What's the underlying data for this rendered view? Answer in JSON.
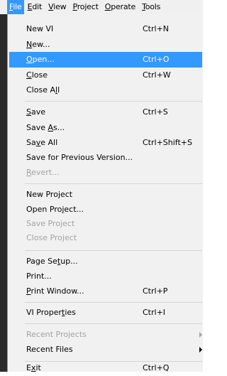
{
  "menubar": {
    "items": [
      {
        "pre": "",
        "ul": "F",
        "post": "ile"
      },
      {
        "pre": "",
        "ul": "E",
        "post": "dit"
      },
      {
        "pre": "",
        "ul": "V",
        "post": "iew"
      },
      {
        "pre": "",
        "ul": "P",
        "post": "roject"
      },
      {
        "pre": "",
        "ul": "O",
        "post": "perate"
      },
      {
        "pre": "",
        "ul": "T",
        "post": "ools"
      }
    ]
  },
  "file_menu": {
    "new_vi": {
      "pre": "New VI",
      "ul": "",
      "post": "",
      "shortcut": "Ctrl+N"
    },
    "new": {
      "pre": "",
      "ul": "N",
      "post": "ew..."
    },
    "open": {
      "pre": "",
      "ul": "O",
      "post": "pen...",
      "shortcut": "Ctrl+O"
    },
    "close": {
      "pre": "",
      "ul": "C",
      "post": "lose",
      "shortcut": "Ctrl+W"
    },
    "close_all": {
      "pre": "Close A",
      "ul": "l",
      "post": "l"
    },
    "save": {
      "pre": "",
      "ul": "S",
      "post": "ave",
      "shortcut": "Ctrl+S"
    },
    "save_as": {
      "pre": "Save ",
      "ul": "A",
      "post": "s..."
    },
    "save_all": {
      "pre": "Sa",
      "ul": "v",
      "post": "e All",
      "shortcut": "Ctrl+Shift+S"
    },
    "save_prev": {
      "pre": "Save for Previous Version...",
      "ul": "",
      "post": ""
    },
    "revert": {
      "pre": "",
      "ul": "R",
      "post": "evert..."
    },
    "new_project": {
      "pre": "New Project",
      "ul": "",
      "post": ""
    },
    "open_project": {
      "pre": "Open Pro",
      "ul": "j",
      "post": "ect..."
    },
    "save_project": {
      "pre": "Save Project",
      "ul": "",
      "post": ""
    },
    "close_project": {
      "pre": "Close Project",
      "ul": "",
      "post": ""
    },
    "page_setup": {
      "pre": "Page Se",
      "ul": "t",
      "post": "up..."
    },
    "print": {
      "pre": "Print...",
      "ul": "",
      "post": ""
    },
    "print_window": {
      "pre": "",
      "ul": "P",
      "post": "rint Window...",
      "shortcut": "Ctrl+P"
    },
    "vi_properties": {
      "pre": "VI Proper",
      "ul": "t",
      "post": "ies",
      "shortcut": "Ctrl+I"
    },
    "recent_projects": {
      "pre": "Recent Projects",
      "ul": "",
      "post": ""
    },
    "recent_files": {
      "pre": "Recent Files",
      "ul": "",
      "post": ""
    },
    "exit": {
      "pre": "E",
      "ul": "x",
      "post": "it",
      "shortcut": "Ctrl+Q"
    }
  },
  "colors": {
    "highlight": "#3399ff",
    "disabled": "#a3a3a3",
    "menu_bg": "#f1f1f1"
  }
}
